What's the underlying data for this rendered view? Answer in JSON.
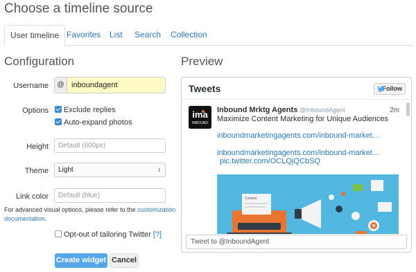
{
  "page": {
    "title": "Choose a timeline source"
  },
  "tabs": [
    {
      "label": "User timeline",
      "active": true
    },
    {
      "label": "Favorites",
      "active": false
    },
    {
      "label": "List",
      "active": false
    },
    {
      "label": "Search",
      "active": false
    },
    {
      "label": "Collection",
      "active": false
    }
  ],
  "config": {
    "heading": "Configuration",
    "username": {
      "label": "Username",
      "prefix": "@",
      "value": "inboundagent"
    },
    "options": {
      "label": "Options",
      "exclude_replies": {
        "label": "Exclude replies",
        "checked": true
      },
      "auto_expand": {
        "label": "Auto-expand photos",
        "checked": true
      }
    },
    "height": {
      "label": "Height",
      "placeholder": "Default (600px)"
    },
    "theme": {
      "label": "Theme",
      "value": "Light",
      "caret": "↕"
    },
    "link_color": {
      "label": "Link color",
      "placeholder": "Default (blue)"
    },
    "advanced_note": {
      "prefix": "For advanced visual options, please refer to the ",
      "link": "customization documentation",
      "suffix": "."
    },
    "opt_out": {
      "label": "Opt-out of tailoring Twitter",
      "help": "[?]",
      "checked": false
    },
    "create_button": "Create widget",
    "cancel_button": "Cancel"
  },
  "preview": {
    "heading": "Preview",
    "widget_title": "Tweets",
    "follow_label": "Follow",
    "tweet": {
      "avatar_text": "ima",
      "avatar_subtext": "INBOUND",
      "author": "Inbound Mrktg Agents",
      "handle": "@InboundAgent",
      "time": "2m",
      "text": "Maximize Content Marketing for Unique Audiences",
      "link1": "inboundmarketingagents.com/inbound-market…",
      "link2": "inboundmarketingagents.com/inbound-market…",
      "link3": "pic.twitter.com/OCLQjQCbSQ",
      "image_label": "Content"
    },
    "reply_placeholder": "Tweet to @InboundAgent"
  },
  "colors": {
    "accent": "#2a7ab8",
    "primary_button": "#55a6e8",
    "username_highlight": "#fdfbc4",
    "tweet_image_bg": "#52b7e0"
  }
}
